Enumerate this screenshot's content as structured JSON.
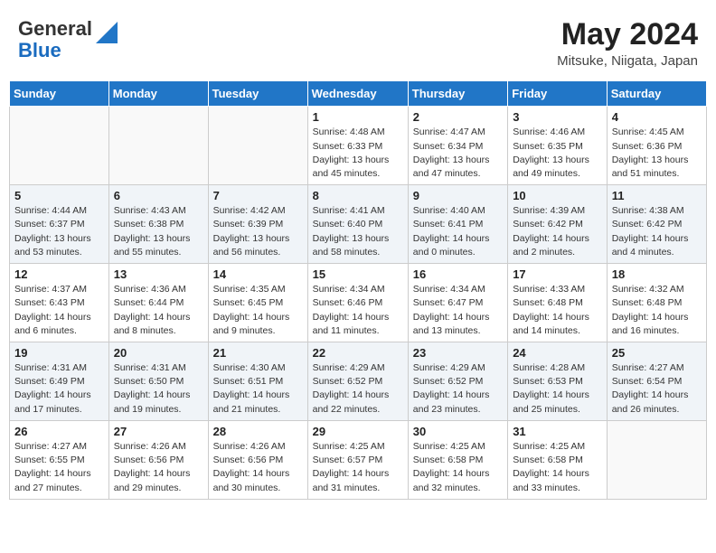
{
  "header": {
    "logo_general": "General",
    "logo_blue": "Blue",
    "title": "May 2024",
    "location": "Mitsuke, Niigata, Japan"
  },
  "days_of_week": [
    "Sunday",
    "Monday",
    "Tuesday",
    "Wednesday",
    "Thursday",
    "Friday",
    "Saturday"
  ],
  "weeks": [
    [
      {
        "day": "",
        "info": ""
      },
      {
        "day": "",
        "info": ""
      },
      {
        "day": "",
        "info": ""
      },
      {
        "day": "1",
        "info": "Sunrise: 4:48 AM\nSunset: 6:33 PM\nDaylight: 13 hours and 45 minutes."
      },
      {
        "day": "2",
        "info": "Sunrise: 4:47 AM\nSunset: 6:34 PM\nDaylight: 13 hours and 47 minutes."
      },
      {
        "day": "3",
        "info": "Sunrise: 4:46 AM\nSunset: 6:35 PM\nDaylight: 13 hours and 49 minutes."
      },
      {
        "day": "4",
        "info": "Sunrise: 4:45 AM\nSunset: 6:36 PM\nDaylight: 13 hours and 51 minutes."
      }
    ],
    [
      {
        "day": "5",
        "info": "Sunrise: 4:44 AM\nSunset: 6:37 PM\nDaylight: 13 hours and 53 minutes."
      },
      {
        "day": "6",
        "info": "Sunrise: 4:43 AM\nSunset: 6:38 PM\nDaylight: 13 hours and 55 minutes."
      },
      {
        "day": "7",
        "info": "Sunrise: 4:42 AM\nSunset: 6:39 PM\nDaylight: 13 hours and 56 minutes."
      },
      {
        "day": "8",
        "info": "Sunrise: 4:41 AM\nSunset: 6:40 PM\nDaylight: 13 hours and 58 minutes."
      },
      {
        "day": "9",
        "info": "Sunrise: 4:40 AM\nSunset: 6:41 PM\nDaylight: 14 hours and 0 minutes."
      },
      {
        "day": "10",
        "info": "Sunrise: 4:39 AM\nSunset: 6:42 PM\nDaylight: 14 hours and 2 minutes."
      },
      {
        "day": "11",
        "info": "Sunrise: 4:38 AM\nSunset: 6:42 PM\nDaylight: 14 hours and 4 minutes."
      }
    ],
    [
      {
        "day": "12",
        "info": "Sunrise: 4:37 AM\nSunset: 6:43 PM\nDaylight: 14 hours and 6 minutes."
      },
      {
        "day": "13",
        "info": "Sunrise: 4:36 AM\nSunset: 6:44 PM\nDaylight: 14 hours and 8 minutes."
      },
      {
        "day": "14",
        "info": "Sunrise: 4:35 AM\nSunset: 6:45 PM\nDaylight: 14 hours and 9 minutes."
      },
      {
        "day": "15",
        "info": "Sunrise: 4:34 AM\nSunset: 6:46 PM\nDaylight: 14 hours and 11 minutes."
      },
      {
        "day": "16",
        "info": "Sunrise: 4:34 AM\nSunset: 6:47 PM\nDaylight: 14 hours and 13 minutes."
      },
      {
        "day": "17",
        "info": "Sunrise: 4:33 AM\nSunset: 6:48 PM\nDaylight: 14 hours and 14 minutes."
      },
      {
        "day": "18",
        "info": "Sunrise: 4:32 AM\nSunset: 6:48 PM\nDaylight: 14 hours and 16 minutes."
      }
    ],
    [
      {
        "day": "19",
        "info": "Sunrise: 4:31 AM\nSunset: 6:49 PM\nDaylight: 14 hours and 17 minutes."
      },
      {
        "day": "20",
        "info": "Sunrise: 4:31 AM\nSunset: 6:50 PM\nDaylight: 14 hours and 19 minutes."
      },
      {
        "day": "21",
        "info": "Sunrise: 4:30 AM\nSunset: 6:51 PM\nDaylight: 14 hours and 21 minutes."
      },
      {
        "day": "22",
        "info": "Sunrise: 4:29 AM\nSunset: 6:52 PM\nDaylight: 14 hours and 22 minutes."
      },
      {
        "day": "23",
        "info": "Sunrise: 4:29 AM\nSunset: 6:52 PM\nDaylight: 14 hours and 23 minutes."
      },
      {
        "day": "24",
        "info": "Sunrise: 4:28 AM\nSunset: 6:53 PM\nDaylight: 14 hours and 25 minutes."
      },
      {
        "day": "25",
        "info": "Sunrise: 4:27 AM\nSunset: 6:54 PM\nDaylight: 14 hours and 26 minutes."
      }
    ],
    [
      {
        "day": "26",
        "info": "Sunrise: 4:27 AM\nSunset: 6:55 PM\nDaylight: 14 hours and 27 minutes."
      },
      {
        "day": "27",
        "info": "Sunrise: 4:26 AM\nSunset: 6:56 PM\nDaylight: 14 hours and 29 minutes."
      },
      {
        "day": "28",
        "info": "Sunrise: 4:26 AM\nSunset: 6:56 PM\nDaylight: 14 hours and 30 minutes."
      },
      {
        "day": "29",
        "info": "Sunrise: 4:25 AM\nSunset: 6:57 PM\nDaylight: 14 hours and 31 minutes."
      },
      {
        "day": "30",
        "info": "Sunrise: 4:25 AM\nSunset: 6:58 PM\nDaylight: 14 hours and 32 minutes."
      },
      {
        "day": "31",
        "info": "Sunrise: 4:25 AM\nSunset: 6:58 PM\nDaylight: 14 hours and 33 minutes."
      },
      {
        "day": "",
        "info": ""
      }
    ]
  ]
}
